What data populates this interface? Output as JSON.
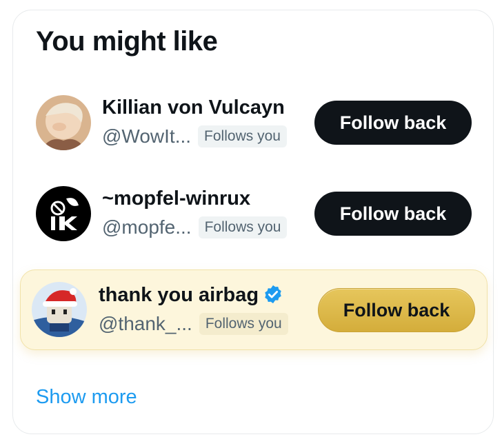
{
  "widget": {
    "title": "You might like",
    "show_more_label": "Show more"
  },
  "suggestions": [
    {
      "name": "Killian von Vulcayn",
      "handle": "@WowIt...",
      "badge": "Follows you",
      "button_label": "Follow back",
      "verified": false,
      "highlighted": false
    },
    {
      "name": "~mopfel-winrux",
      "handle": "@mopfe...",
      "badge": "Follows you",
      "button_label": "Follow back",
      "verified": false,
      "highlighted": false
    },
    {
      "name": "thank you airbag",
      "handle": "@thank_...",
      "badge": "Follows you",
      "button_label": "Follow back",
      "verified": true,
      "highlighted": true
    }
  ],
  "colors": {
    "link": "#1d9bf0",
    "button_dark": "#0f1419",
    "button_gold": "#d4ad3b",
    "highlight_bg": "#fdf6dc",
    "verified": "#1d9bf0"
  }
}
